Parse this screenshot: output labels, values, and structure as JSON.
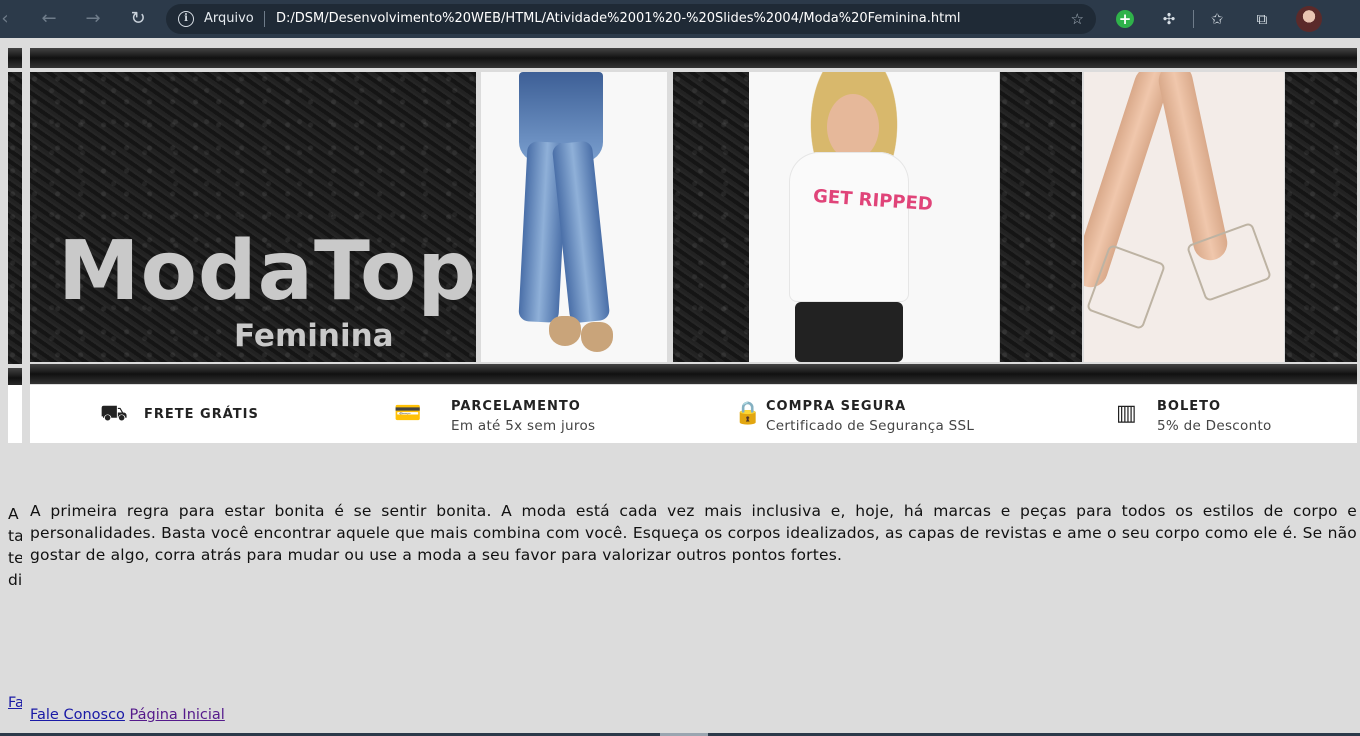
{
  "browser": {
    "scheme_label": "Arquivo",
    "url": "D:/DSM/Desenvolvimento%20WEB/HTML/Atividade%2001%20-%20Slides%2004/Moda%20Feminina.html"
  },
  "banner": {
    "brand": "ModaTop",
    "subtitle": "Feminina",
    "shirt_print": "GET RIPPED"
  },
  "features": [
    {
      "icon": "truck-icon",
      "title": "FRETE GRÁTIS",
      "subtitle": ""
    },
    {
      "icon": "card-icon",
      "title": "PARCELAMENTO",
      "subtitle": "Em até 5x sem juros"
    },
    {
      "icon": "lock-icon",
      "title": "COMPRA SEGURA",
      "subtitle": "Certificado de Segurança SSL"
    },
    {
      "icon": "barcode-icon",
      "title": "BOLETO",
      "subtitle": "5% de Desconto"
    }
  ],
  "main": {
    "paragraph": "A primeira regra para estar bonita é se sentir bonita. A moda está cada vez mais inclusiva e, hoje, há marcas e peças para todos os estilos de corpo e personalidades. Basta você encontrar aquele que mais combina com você. Esqueça os corpos idealizados, as capas de revistas e ame o seu corpo como ele é. Se não gostar de algo, corra atrás para mudar ou use a moda a seu favor para valorizar outros pontos fortes.",
    "left_clip": "A ta te di"
  },
  "footer": {
    "contact_label": "Fale Conosco",
    "home_label": "Página Inicial",
    "left_clip": "Fa"
  }
}
